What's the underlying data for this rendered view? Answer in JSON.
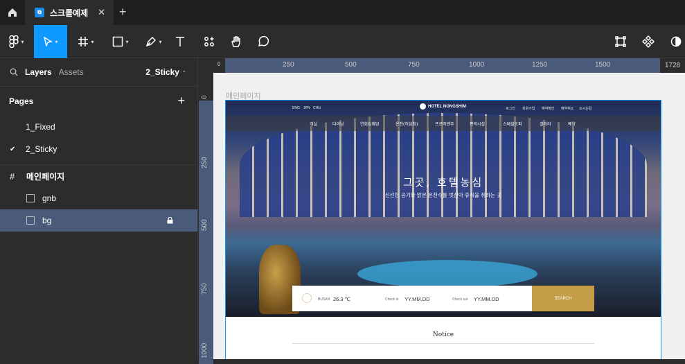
{
  "tabbar": {
    "file_name": "스크롤예제",
    "close_glyph": "✕",
    "new_tab_glyph": "+"
  },
  "left_panel": {
    "tabs": {
      "layers": "Layers",
      "assets": "Assets"
    },
    "current_page": "2_Sticky",
    "pages_title": "Pages",
    "add_page_glyph": "+",
    "pages": [
      {
        "name": "1_Fixed",
        "selected": false
      },
      {
        "name": "2_Sticky",
        "selected": true
      }
    ],
    "frame_name": "메인페이지",
    "layers": [
      {
        "name": "gnb",
        "selected": false
      },
      {
        "name": "bg",
        "selected": true
      }
    ]
  },
  "rulers": {
    "top": [
      "0",
      "250",
      "500",
      "750",
      "1000",
      "1250",
      "1500"
    ],
    "top_end": "1728",
    "left": [
      "0",
      "250",
      "500",
      "750",
      "1000"
    ]
  },
  "canvas": {
    "frame_label": "메인페이지",
    "site": {
      "logo": "HOTEL NONGSHIM",
      "top_left_links": [
        "ENG",
        "JPN",
        "CHN"
      ],
      "top_right_links": [
        "로그인",
        "회원가입",
        "예약확인",
        "예약취소",
        "오시는길"
      ],
      "nav": [
        "객실",
        "다이닝",
        "연회&웨딩",
        "온천(허심청)",
        "프로미엔주",
        "편의시설",
        "스페셜오퍼",
        "갤러리",
        "예약"
      ],
      "headline": "그곳, 호텔농심",
      "subline": "신선한 공기와 맑은 온천수를 벗삼아 휴식을 취하는 곳",
      "booking": {
        "city": "BUSAN",
        "temperature": "26.3 ℃",
        "checkin_label": "Check in",
        "checkin_value": "YY.MM.DD",
        "checkout_label": "Check out",
        "checkout_value": "YY.MM.DD",
        "search": "SEARCH"
      },
      "notice_title": "Notice"
    }
  },
  "colors": {
    "accent": "#0d99ff",
    "selection": "#4a5a7a",
    "gold": "#c59c47"
  }
}
